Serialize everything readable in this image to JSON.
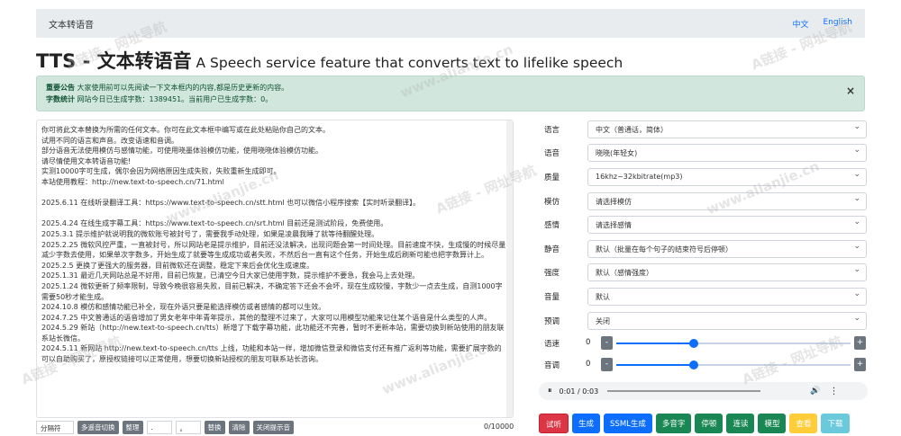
{
  "navbar": {
    "brand": "文本转语音",
    "lang_zh": "中文",
    "lang_en": "English"
  },
  "heading": {
    "main": "TTS - 文本转语音",
    "sub": " A Speech service feature that converts text to lifelike speech"
  },
  "alert": {
    "line1_label": "重要公告",
    "line1_text": " 大家使用前可以先阅读一下文本框内的内容,都是历史更新的内容。",
    "line2_label": "字数统计",
    "line2_text": " 网站今日已生成字数：1389451。当前用户已生成字数：0。",
    "close": "×"
  },
  "textarea": {
    "lines": [
      "你可将此文本替换为所需的任何文本。你可在此文本框中编写或在此处粘贴你自己的文本。",
      "试用不同的语言和声音。改变语速和音调。",
      "部分语音无法使用模仿与感情功能，可使用晓墨体验模仿功能，使用晓晓体验模仿功能。",
      "请尽情使用文本转语音功能!",
      "实测10000字可生成，偶尔会因为网络原因生成失败，失败重新生成即可。",
      "本站使用教程：http://new.text-to-speech.cn/71.html",
      "",
      "2025.6.11 在线听录翻译工具：https://www.text-to-speech.cn/stt.html 也可以微信小程序搜索【实时听录翻译】。",
      "",
      "2025.4.24 在线生成字幕工具：https://www.text-to-speech.cn/srt.html 目前还是测试阶段，免费使用。",
      "2025.3.1 提示维护就说明我的微软账号被封号了，需要我手动处理，如果是凌晨我睡了就等待翻醒处理。",
      "2025.2.25 微软风控严重，一直被封号，所以网站老是提示维护，目前还没法解决，出现问题会第一时间处理。目前速度不快，生成慢的时候尽量减少字数去使用，如果单次字数多，开始生成了就要等生成成功或者失败，不然后台一直有这个任务，开始生成后刷新可能也把字数算计上。",
      "2025.2.5 更换了更强大的服务器，目前微软还在调整，稳定下来后会优化生成速度。",
      "2025.1.31 最近几天网站总是不好用，目前已恢复，已清空今日大家已使用字数，提示维护不要急，我会马上去处理。",
      "2025.1.24 微软更新了频率限制，导致今晚很容易失败，目前已解决，不确定答下还会不会坏，现在生成较慢，字数少一点去生成，自测1000字需要50秒才能生成。",
      "2024.10.8 模仿和感情功能已补全，现在外语只要是能选择模仿或者感情的都可以生效。",
      "2024.7.25 中文普通话的语音增加了男女老年中年青年提示，其他的整理不过来了，大家可以用模型功能来记住某个语音是什么类型的人声。",
      "2024.5.29 新站（http://new.text-to-speech.cn/tts）新增了下载字幕功能，此功能还不完善，暂时不更新本站，需要切换到新站使用的朋友联系站长微信。",
      "2024.5.11 新网站 http://new.text-to-speech.cn/tts 上线，功能和本站一样，增加微信登录和微信支付还有推广返利等功能，需要扩展字数的可以自助购买了，原授权链接可以正常使用，想要切换新站授权的朋友可联系站长咨询。"
    ],
    "counter": "0/10000"
  },
  "bottom_bar": {
    "separator_placeholder": "分隔符",
    "btn_multi": "多遥音切换",
    "btn_organize": "整理",
    "input2": ".",
    "input3": "。",
    "btn_replace": "替换",
    "btn_clear": "清除",
    "btn_close_hint": "关闭提示音"
  },
  "form": {
    "language": {
      "label": "语言",
      "value": "中文（普通话，简体）"
    },
    "voice": {
      "label": "语音",
      "value": "晓晓(年轻女)"
    },
    "quality": {
      "label": "质量",
      "value": "16khz~32kbitrate(mp3)"
    },
    "imitate": {
      "label": "模仿",
      "value": "请选择模仿"
    },
    "emotion": {
      "label": "感情",
      "value": "请选择感情"
    },
    "silence": {
      "label": "静音",
      "value": "默认（批量在每个句子的结束符号后停顿）"
    },
    "intensity": {
      "label": "强度",
      "value": "默认（感情强度）"
    },
    "volume": {
      "label": "音量",
      "value": "默认"
    },
    "preview": {
      "label": "预调",
      "value": "关闭"
    },
    "speed": {
      "label": "语速",
      "value": "0",
      "minus": "-",
      "plus": "+",
      "level": 0.33
    },
    "pitch": {
      "label": "音调",
      "value": "0",
      "minus": "-",
      "plus": "+",
      "level": 0.33
    }
  },
  "audio": {
    "play_icon": "⏸",
    "time": "0:01 / 0:03",
    "volume_icon": "🔊",
    "more_icon": "⋮"
  },
  "actions": {
    "listen": "试听",
    "generate": "生成",
    "ssml": "SSML生成",
    "multi_voice": "多音字",
    "pause": "停顿",
    "liaison": "连读",
    "model": "模型",
    "view": "查看",
    "download": "下载"
  },
  "watermark": {
    "cn": "A链接 - 网址导航",
    "en": "www.alianjie.cn"
  },
  "colors": {
    "primary": "#0d6efd",
    "danger": "#dc3545",
    "success": "#198754",
    "warning": "#ffc107",
    "info": "#6bc9dc",
    "alert_bg": "#d1e7dd"
  }
}
